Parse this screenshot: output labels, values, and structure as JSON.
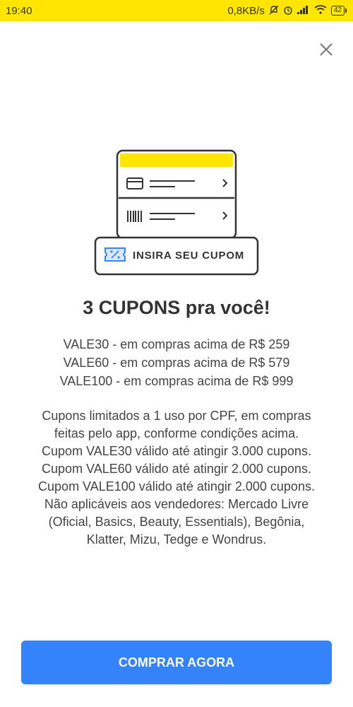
{
  "status_bar": {
    "time": "19:40",
    "network_speed": "0,8KB/s",
    "battery": "42",
    "icons": [
      "mute-icon",
      "alarm-icon",
      "signal-icon",
      "wifi-icon",
      "battery-icon"
    ]
  },
  "illustration": {
    "coupon_label": "INSIRA SEU CUPOM",
    "accent_color": "#ffe600"
  },
  "title": "3 CUPONS pra você!",
  "coupons": [
    "VALE30 - em compras acima de R$ 259",
    "VALE60 - em compras acima de R$ 579",
    "VALE100 - em compras acima de R$ 999"
  ],
  "terms": [
    "Cupons limitados a 1 uso por CPF, em compras",
    "feitas pelo app, conforme condições acima.",
    "Cupom VALE30 válido até atingir 3.000 cupons.",
    "Cupom VALE60 válido até atingir 2.000 cupons.",
    "Cupom VALE100 válido até atingir 2.000 cupons.",
    "Não aplicáveis aos vendedores: Mercado Livre",
    "(Oficial, Basics, Beauty, Essentials), Begônia,",
    "Klatter, Mizu, Tedge e Wondrus."
  ],
  "cta": {
    "label": "COMPRAR AGORA",
    "color": "#3483fa"
  }
}
